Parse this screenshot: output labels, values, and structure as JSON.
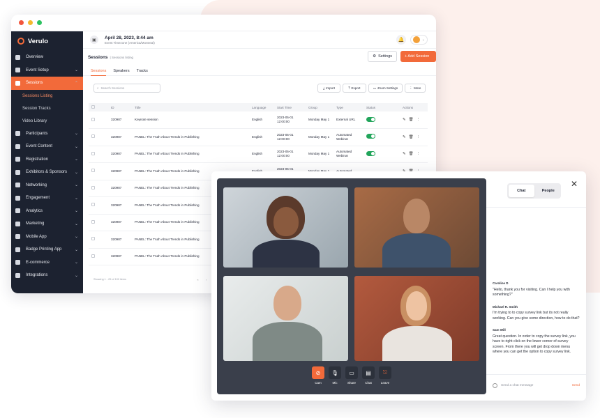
{
  "app": {
    "name": "Verulo"
  },
  "header": {
    "datetime": "April 28, 2023, 8:44 am",
    "timezone": "Event Timezone (America/Montreal)"
  },
  "sidebar": {
    "items": [
      {
        "label": "Overview",
        "icon": "info-icon",
        "chevron": false
      },
      {
        "label": "Event Setup",
        "icon": "gear-icon",
        "chevron": true
      },
      {
        "label": "Sessions",
        "icon": "grid-icon",
        "chevron": true,
        "active": true
      },
      {
        "label": "Participants",
        "icon": "users-icon",
        "chevron": true
      },
      {
        "label": "Event Content",
        "icon": "content-icon",
        "chevron": true
      },
      {
        "label": "Registration",
        "icon": "user-plus-icon",
        "chevron": true
      },
      {
        "label": "Exhibitors & Sponsors",
        "icon": "puzzle-icon",
        "chevron": true
      },
      {
        "label": "Networking",
        "icon": "share-icon",
        "chevron": true
      },
      {
        "label": "Engagement",
        "icon": "flag-icon",
        "chevron": true
      },
      {
        "label": "Analytics",
        "icon": "chart-icon",
        "chevron": true
      },
      {
        "label": "Marketing",
        "icon": "send-icon",
        "chevron": true
      },
      {
        "label": "Mobile App",
        "icon": "phone-icon",
        "chevron": true
      },
      {
        "label": "Badge Printing App",
        "icon": "printer-icon",
        "chevron": true
      },
      {
        "label": "E-commerce",
        "icon": "cart-icon",
        "chevron": true
      },
      {
        "label": "Integrations",
        "icon": "plus-square-icon",
        "chevron": true
      }
    ],
    "subitems": [
      "Sessions Listing",
      "Session Tracks",
      "Video Library"
    ]
  },
  "page": {
    "title": "Sessions",
    "crumb": "| Sessions listing",
    "settings": "Settings",
    "add": "+ Add Session"
  },
  "tabs": [
    "Sessions",
    "Speakers",
    "Tracks"
  ],
  "toolbar": {
    "search_placeholder": "Search Sessions",
    "import": "Import",
    "export": "Export",
    "zoom": "Zoom Settings",
    "more": "More"
  },
  "table": {
    "headers": [
      "",
      "ID",
      "Title",
      "Language",
      "Start Time",
      "Group",
      "Type",
      "Status",
      "Actions"
    ],
    "rows": [
      [
        "320987",
        "Keynote session",
        "English",
        "2023-05-01 12:00:00",
        "Monday May 1",
        "External URL"
      ],
      [
        "320987",
        "PANEL: The Truth About Trends in Publishing",
        "English",
        "2023-05-01 12:00:00",
        "Monday May 1",
        "Automated Webinar"
      ],
      [
        "320987",
        "PANEL: The Truth About Trends in Publishing",
        "English",
        "2023-05-01 12:00:00",
        "Monday May 1",
        "Automated Webinar"
      ],
      [
        "320987",
        "PANEL: The Truth About Trends in Publishing",
        "English",
        "2023-05-01 12:00:00",
        "Monday May 1",
        "Automated"
      ],
      [
        "320987",
        "PANEL: The Truth About Trends in Publishing",
        "",
        "",
        "",
        ""
      ],
      [
        "320987",
        "PANEL: The Truth About Trends in Publishing",
        "",
        "",
        "",
        ""
      ],
      [
        "320987",
        "PANEL: The Truth About Trends in Publishing",
        "",
        "",
        "",
        ""
      ],
      [
        "320987",
        "PANEL: The Truth About Trends in Publishing",
        "",
        "",
        "",
        ""
      ],
      [
        "320987",
        "PANEL: The Truth About Trends in Publishing",
        "",
        "",
        "",
        ""
      ]
    ]
  },
  "pager": {
    "text": "Showing 1 - 25 of 100 items"
  },
  "video": {
    "controls": [
      "Cam",
      "Mic",
      "Share",
      "Chat",
      "Leave"
    ]
  },
  "chat": {
    "tabs": [
      "Chat",
      "People"
    ],
    "placeholder": "Send a chat message",
    "send": "Send",
    "messages": [
      {
        "name": "Caroline D",
        "text": "\"Hello, thank you for visiting. Can I help you with something?\""
      },
      {
        "name": "Michael R. Smith",
        "text": "I'm trying to to copy survey link but its not really working. Can you give some direction, how to do that?"
      },
      {
        "name": "Sam Will",
        "text": "Great question. In order to copy the survey link, you have to right click on the lower corner of survey screen. From there you will get drop down menu where you can get the option to copy survey link."
      }
    ]
  },
  "colors": {
    "accent": "#f26a3a",
    "sidebar": "#1c2230",
    "toggle": "#22a55b"
  }
}
